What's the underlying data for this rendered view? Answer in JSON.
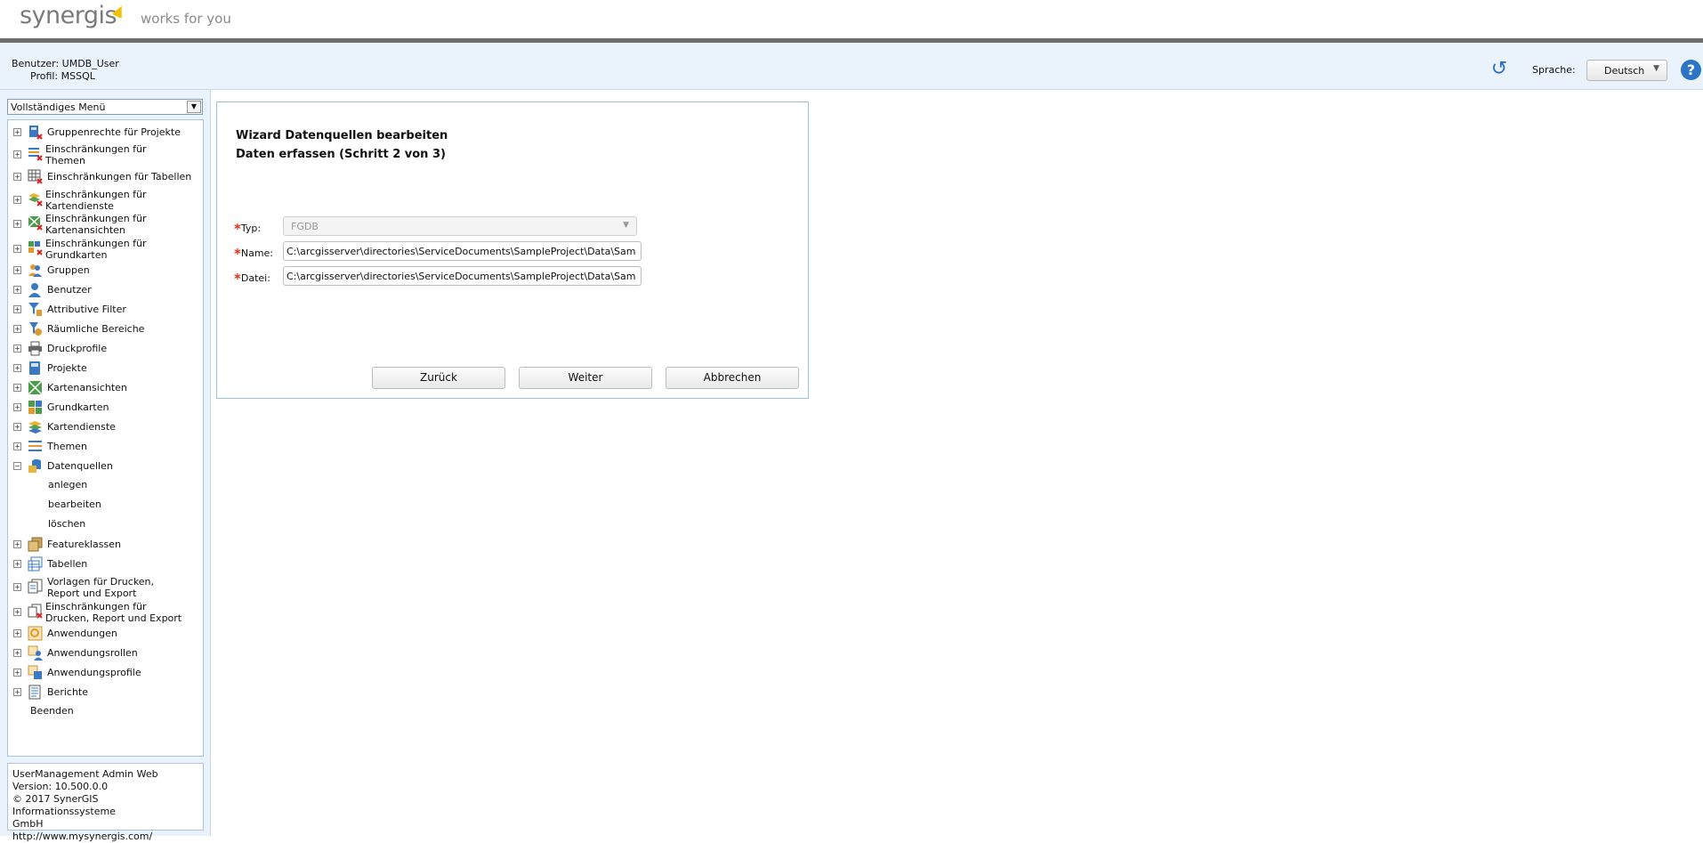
{
  "brand": {
    "logo_text": "synergis",
    "tagline": "works for you"
  },
  "user": {
    "benutzer_label": "Benutzer:",
    "benutzer_value": "UMDB_User",
    "profil_label": "Profil:",
    "profil_value": "MSSQL"
  },
  "language": {
    "label": "Sprache:",
    "value": "Deutsch"
  },
  "sidebar": {
    "menu_select": "Vollständiges Menü",
    "items": [
      {
        "label": "Gruppenrechte für Projekte",
        "icon": "group-rights-icon"
      },
      {
        "label": "Einschränkungen für\nThemen",
        "icon": "theme-restriction-icon"
      },
      {
        "label": "Einschränkungen für Tabellen",
        "icon": "table-restriction-icon"
      },
      {
        "label": "Einschränkungen für\nKartendienste",
        "icon": "mapservice-restriction-icon"
      },
      {
        "label": "Einschränkungen für\nKartenansichten",
        "icon": "mapview-restriction-icon"
      },
      {
        "label": "Einschränkungen für\nGrundkarten",
        "icon": "basemap-restriction-icon"
      },
      {
        "label": "Gruppen",
        "icon": "groups-icon"
      },
      {
        "label": "Benutzer",
        "icon": "user-icon"
      },
      {
        "label": "Attributive Filter",
        "icon": "filter-icon"
      },
      {
        "label": "Räumliche Bereiche",
        "icon": "spatial-area-icon"
      },
      {
        "label": "Druckprofile",
        "icon": "printer-icon"
      },
      {
        "label": "Projekte",
        "icon": "project-icon"
      },
      {
        "label": "Kartenansichten",
        "icon": "mapview-icon"
      },
      {
        "label": "Grundkarten",
        "icon": "basemap-icon"
      },
      {
        "label": "Kartendienste",
        "icon": "mapservice-icon"
      },
      {
        "label": "Themen",
        "icon": "theme-icon"
      },
      {
        "label": "Datenquellen",
        "icon": "datasource-icon"
      },
      {
        "label": "Featureklassen",
        "icon": "featureclass-icon"
      },
      {
        "label": "Tabellen",
        "icon": "tables-icon"
      },
      {
        "label": "Vorlagen für Drucken,\nReport und Export",
        "icon": "template-icon"
      },
      {
        "label": "Einschränkungen für\nDrucken, Report und Export",
        "icon": "print-restriction-icon"
      },
      {
        "label": "Anwendungen",
        "icon": "application-icon"
      },
      {
        "label": "Anwendungsrollen",
        "icon": "application-role-icon"
      },
      {
        "label": "Anwendungsprofile",
        "icon": "application-profile-icon"
      },
      {
        "label": "Berichte",
        "icon": "report-icon"
      }
    ],
    "datenquellen_children": [
      "anlegen",
      "bearbeiten",
      "löschen"
    ],
    "beenden": "Beenden"
  },
  "version": {
    "line1": "UserManagement Admin Web",
    "line2": "Version: 10.500.0.0",
    "line3": "© 2017 SynerGIS Informationssysteme",
    "line4": "GmbH",
    "link": "http://www.mysynergis.com/"
  },
  "wizard": {
    "title": "Wizard Datenquellen bearbeiten",
    "subtitle": "Daten erfassen (Schritt 2 von 3)",
    "typ_label": "Typ:",
    "typ_value": "FGDB",
    "name_label": "Name:",
    "name_value": "C:\\arcgisserver\\directories\\ServiceDocuments\\SampleProject\\Data\\SampleProject.gdb",
    "datei_label": "Datei:",
    "datei_value": "C:\\arcgisserver\\directories\\ServiceDocuments\\SampleProject\\Data\\SampleProject.gdb",
    "back": "Zurück",
    "next": "Weiter",
    "cancel": "Abbrechen"
  }
}
